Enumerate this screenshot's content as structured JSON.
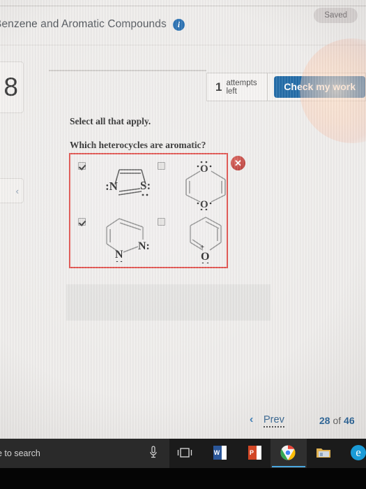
{
  "header": {
    "chapter_title": "Benzene and Aromatic Compounds",
    "info_icon": "info-icon",
    "saved_badge": "Saved"
  },
  "toolbar": {
    "question_number": "8",
    "prev_arrow": "‹",
    "attempts_count": "1",
    "attempts_label": "attempts left",
    "check_my_work_label": "Check my work"
  },
  "question": {
    "instruction": "Select all that apply.",
    "prompt": "Which heterocycles are aromatic?",
    "result_marker": "✕",
    "options": [
      {
        "id": "option-thiazole",
        "checked": true,
        "structure": "thiazole",
        "ring_size": 5,
        "atom_labels": [
          ":N",
          "S:"
        ]
      },
      {
        "id": "option-dioxine",
        "checked": false,
        "structure": "1,4-dioxine",
        "ring_size": 6,
        "atom_labels": [
          "O",
          "O"
        ]
      },
      {
        "id": "option-pyridazine",
        "checked": true,
        "structure": "pyridazine",
        "ring_size": 6,
        "atom_labels": [
          "N:",
          "N"
        ]
      },
      {
        "id": "option-pyrylium",
        "checked": false,
        "structure": "pyrylium",
        "ring_size": 6,
        "atom_labels": [
          "O",
          "+"
        ]
      }
    ]
  },
  "footer": {
    "prev_chevron": "‹",
    "prev_label": "Prev",
    "page_current": "28",
    "page_of": "of",
    "page_total": "46"
  },
  "taskbar": {
    "search_placeholder": "e to search",
    "mic_icon": "microphone-icon",
    "taskview_icon": "task-view-icon",
    "word_label": "W",
    "ppt_label": "P",
    "chrome_icon": "chrome-icon",
    "explorer_icon": "file-explorer-icon",
    "edge_label": "e"
  },
  "colors": {
    "accent_blue": "#1463a3",
    "error_red": "#e0443f",
    "link_blue": "#2b5f8e"
  }
}
